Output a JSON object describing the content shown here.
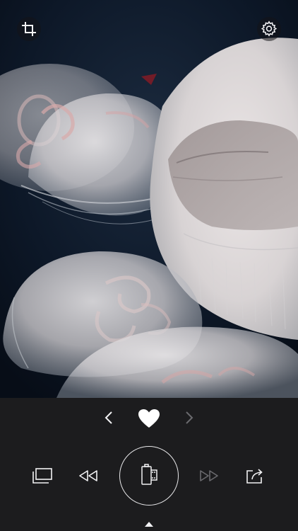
{
  "screen": {
    "name": "jellyfish-photo-viewer"
  },
  "photo": {
    "subject": "moon jellyfish"
  },
  "top_bar": {
    "crop": {
      "icon": "crop-icon"
    },
    "settings": {
      "icon": "gear-icon"
    }
  },
  "navigation": {
    "previous": {
      "icon": "chevron-left-icon",
      "enabled": true
    },
    "favorite": {
      "icon": "heart-filled-icon",
      "active": true
    },
    "next": {
      "icon": "chevron-right-icon",
      "enabled": false
    }
  },
  "toolbar": {
    "gallery": {
      "icon": "stacked-photos-icon",
      "enabled": true
    },
    "rewind": {
      "icon": "rewind-icon",
      "enabled": true
    },
    "capture": {
      "icon": "film-canister-icon"
    },
    "fast_forward": {
      "icon": "fast-forward-icon",
      "enabled": false
    },
    "share": {
      "icon": "share-icon",
      "enabled": true
    }
  },
  "drawer": {
    "icon": "triangle-up-icon"
  },
  "colors": {
    "panel_background": "#1c1c1e",
    "icon_active": "#f2f2f4",
    "icon_disabled": "#6a6a6e",
    "photo_background": "#0f1a2a"
  }
}
